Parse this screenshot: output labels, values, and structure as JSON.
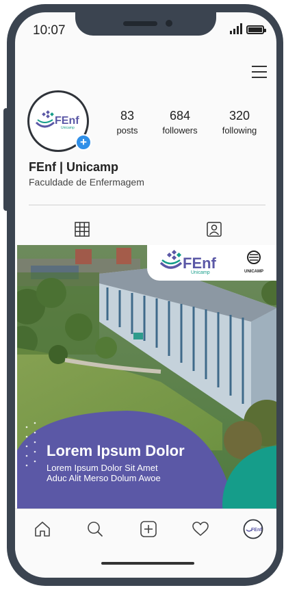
{
  "status_bar": {
    "time": "10:07"
  },
  "profile": {
    "name": "FEnf | Unicamp",
    "bio": "Faculdade de Enfermagem",
    "logo_text": "FEnf",
    "logo_subtext": "Unicamp",
    "stats": [
      {
        "value": "83",
        "label": "posts"
      },
      {
        "value": "684",
        "label": "followers"
      },
      {
        "value": "320",
        "label": "following"
      }
    ]
  },
  "post": {
    "logo_text": "FEnf",
    "logo_subtext": "Unicamp",
    "partner_text": "UNICAMP",
    "headline": "Lorem Ipsum Dolor",
    "subline_1": "Lorem Ipsum Dolor Sit Amet",
    "subline_2": "Aduc Alit Merso Dolum Awoe"
  },
  "nav": {
    "profile_logo_text": "FEnf"
  },
  "colors": {
    "accent_blue": "#2f8fe8",
    "brand_purple": "#5b58a6",
    "brand_teal": "#159d8a",
    "phone_frame": "#3b4450"
  }
}
